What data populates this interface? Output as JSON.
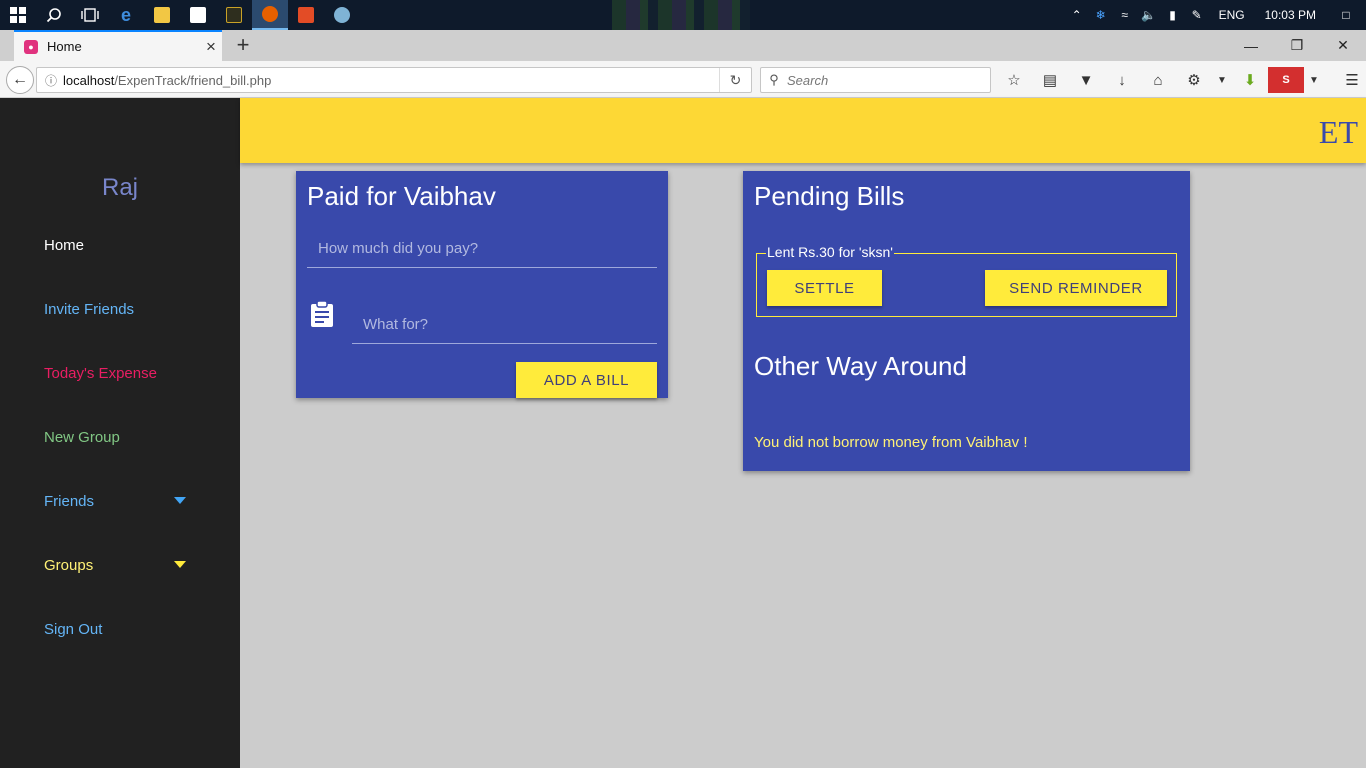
{
  "taskbar": {
    "tray_lang": "ENG",
    "tray_time": "10:03 PM"
  },
  "browser": {
    "tab_title": "Home",
    "url_host": "localhost",
    "url_path": "/ExpenTrack/friend_bill.php",
    "search_placeholder": "Search"
  },
  "sidebar": {
    "user_name": "Raj",
    "items": [
      {
        "label": "Home",
        "color": "#ffffff"
      },
      {
        "label": "Invite Friends",
        "color": "#64b5f6"
      },
      {
        "label": "Today's Expense",
        "color": "#e91e63"
      },
      {
        "label": "New Group",
        "color": "#81c784"
      },
      {
        "label": "Friends",
        "color": "#64b5f6"
      },
      {
        "label": "Groups",
        "color": "#fff176"
      },
      {
        "label": "Sign Out",
        "color": "#64b5f6"
      }
    ]
  },
  "header": {
    "brand": "ET"
  },
  "paid_card": {
    "title": "Paid for Vaibhav",
    "amount_placeholder": "How much did you pay?",
    "description_placeholder": "What for?",
    "add_button": "ADD A BILL"
  },
  "pending_card": {
    "title": "Pending Bills",
    "bill_legend": "Lent Rs.30 for 'sksn'",
    "settle_button": "SETTLE",
    "reminder_button": "SEND REMINDER",
    "other_title": "Other Way Around",
    "other_note": "You did not borrow money from Vaibhav !"
  },
  "colors": {
    "primary": "#3949ab",
    "accent": "#ffeb3b",
    "header": "#fdd835",
    "sidebar": "#212121"
  }
}
